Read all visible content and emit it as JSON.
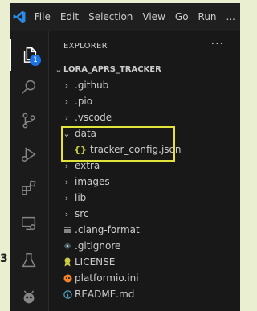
{
  "menu": [
    "File",
    "Edit",
    "Selection",
    "View",
    "Go",
    "Run",
    "..."
  ],
  "activity": [
    {
      "name": "explorer-icon",
      "badge": "1"
    },
    {
      "name": "search-icon"
    },
    {
      "name": "source-control-icon"
    },
    {
      "name": "run-debug-icon"
    },
    {
      "name": "extensions-icon"
    },
    {
      "name": "remote-explorer-icon"
    },
    {
      "name": "testing-icon"
    },
    {
      "name": "platformio-icon"
    }
  ],
  "explorer": {
    "title": "EXPLORER",
    "more": "···",
    "root": "LORA_APRS_TRACKER",
    "items": [
      {
        "label": ".github",
        "kind": "folder",
        "depth": 1
      },
      {
        "label": ".pio",
        "kind": "folder",
        "depth": 1
      },
      {
        "label": ".vscode",
        "kind": "folder",
        "depth": 1
      },
      {
        "label": "data",
        "kind": "folder-open",
        "depth": 1
      },
      {
        "label": "tracker_config.json",
        "kind": "json",
        "depth": 2,
        "icon_text": "{}"
      },
      {
        "label": "extra",
        "kind": "folder",
        "depth": 1
      },
      {
        "label": "images",
        "kind": "folder",
        "depth": 1
      },
      {
        "label": "lib",
        "kind": "folder",
        "depth": 1
      },
      {
        "label": "src",
        "kind": "folder",
        "depth": 1
      },
      {
        "label": ".clang-format",
        "kind": "lines",
        "depth": 1
      },
      {
        "label": ".gitignore",
        "kind": "git",
        "depth": 1
      },
      {
        "label": "LICENSE",
        "kind": "license",
        "depth": 1
      },
      {
        "label": "platformio.ini",
        "kind": "platformio",
        "depth": 1
      },
      {
        "label": "README.md",
        "kind": "info",
        "depth": 1
      }
    ]
  },
  "edge_mark": "3",
  "colors": {
    "highlight": "#e2e23a",
    "accent": "#1a73e8"
  }
}
